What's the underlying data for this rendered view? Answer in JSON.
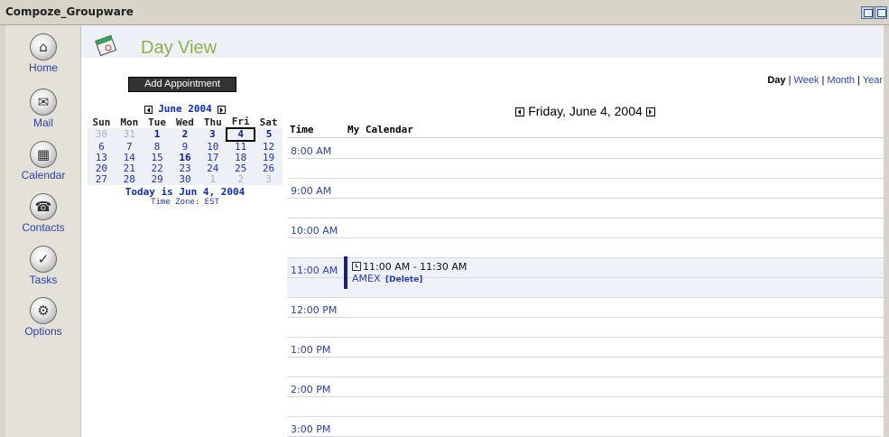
{
  "app": {
    "title": "Compoze_Groupware"
  },
  "sidebar": {
    "items": [
      {
        "label": "Home",
        "icon": "home-icon"
      },
      {
        "label": "Mail",
        "icon": "mail-icon"
      },
      {
        "label": "Calendar",
        "icon": "calendar-icon"
      },
      {
        "label": "Contacts",
        "icon": "contacts-icon"
      },
      {
        "label": "Tasks",
        "icon": "tasks-icon"
      },
      {
        "label": "Options",
        "icon": "options-icon"
      }
    ]
  },
  "header": {
    "title": "Day View"
  },
  "toolbar": {
    "add_appointment_label": "Add Appointment"
  },
  "view_links": {
    "day": "Day",
    "week": "Week",
    "month": "Month",
    "year": "Year",
    "separator": " | "
  },
  "mini_calendar": {
    "month_label": "June 2004",
    "weekdays": [
      "Sun",
      "Mon",
      "Tue",
      "Wed",
      "Thu",
      "Fri",
      "Sat"
    ],
    "weeks": [
      [
        "30",
        "31",
        "1",
        "2",
        "3",
        "4",
        "5"
      ],
      [
        "6",
        "7",
        "8",
        "9",
        "10",
        "11",
        "12"
      ],
      [
        "13",
        "14",
        "15",
        "16",
        "17",
        "18",
        "19"
      ],
      [
        "20",
        "21",
        "22",
        "23",
        "24",
        "25",
        "26"
      ],
      [
        "27",
        "28",
        "29",
        "30",
        "1",
        "2",
        "3"
      ]
    ],
    "selected_day": "4",
    "today_label": "Today is Jun 4, 2004",
    "timezone_label": "Time Zone: EST"
  },
  "day_view": {
    "date_label": "Friday, June 4, 2004",
    "col_time": "Time",
    "col_calendar": "My Calendar",
    "time_labels": [
      "8:00 AM",
      "9:00 AM",
      "10:00 AM",
      "11:00 AM",
      "12:00 PM",
      "1:00 PM",
      "2:00 PM",
      "3:00 PM"
    ],
    "appointment": {
      "time_range": "11:00 AM - 11:30 AM",
      "title": "AMEX",
      "delete_label": "[Delete]"
    }
  },
  "colors": {
    "title_green": "#8cb14b",
    "link_blue": "#2c46b8",
    "appointment_bar": "#17208a"
  }
}
